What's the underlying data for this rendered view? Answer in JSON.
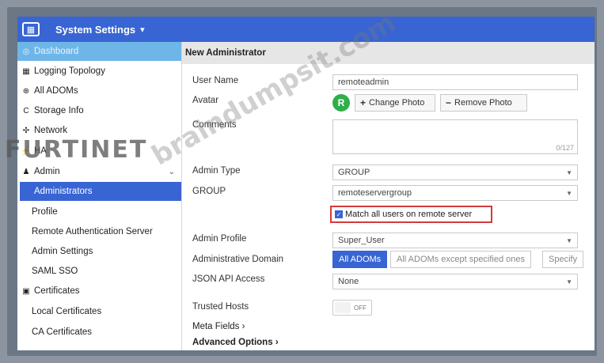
{
  "header": {
    "title": "System Settings",
    "logo_icon": "fortinet-grid-icon"
  },
  "sidebar": {
    "items": [
      {
        "label": "Dashboard",
        "icon": "dashboard-icon"
      },
      {
        "label": "Logging Topology",
        "icon": "topology-icon"
      },
      {
        "label": "All ADOMs",
        "icon": "globe-icon"
      },
      {
        "label": "Storage Info",
        "icon": "storage-icon"
      },
      {
        "label": "Network",
        "icon": "network-icon"
      },
      {
        "label": "HA",
        "icon": "ha-icon"
      },
      {
        "label": "Admin",
        "icon": "user-icon"
      },
      {
        "label": "Administrators"
      },
      {
        "label": "Profile"
      },
      {
        "label": "Remote Authentication Server"
      },
      {
        "label": "Admin Settings"
      },
      {
        "label": "SAML SSO"
      },
      {
        "label": "Certificates",
        "icon": "certificate-icon"
      },
      {
        "label": "Local Certificates"
      },
      {
        "label": "CA Certificates"
      }
    ]
  },
  "form": {
    "title": "New Administrator",
    "user_name_label": "User Name",
    "user_name_value": "remoteadmin",
    "avatar_label": "Avatar",
    "avatar_letter": "R",
    "change_photo": "Change Photo",
    "remove_photo": "Remove Photo",
    "comments_label": "Comments",
    "comments_count": "0/127",
    "admin_type_label": "Admin Type",
    "admin_type_value": "GROUP",
    "group_label": "GROUP",
    "group_value": "remoteservergroup",
    "match_label": "Match all users on remote server",
    "admin_profile_label": "Admin Profile",
    "admin_profile_value": "Super_User",
    "admin_domain_label": "Administrative Domain",
    "domain_options": [
      "All ADOMs",
      "All ADOMs except specified ones",
      "Specify"
    ],
    "json_api_label": "JSON API Access",
    "json_api_value": "None",
    "trusted_hosts_label": "Trusted Hosts",
    "trusted_hosts_toggle": "OFF",
    "meta_fields": "Meta Fields",
    "advanced_options": "Advanced Options"
  },
  "watermarks": {
    "brand": "FURTINET",
    "site": "braindumpsit.com"
  },
  "colors": {
    "topbar": "#3865d3",
    "active": "#3865d3",
    "highlight": "#d23b3b",
    "avatar": "#2fae4a"
  }
}
